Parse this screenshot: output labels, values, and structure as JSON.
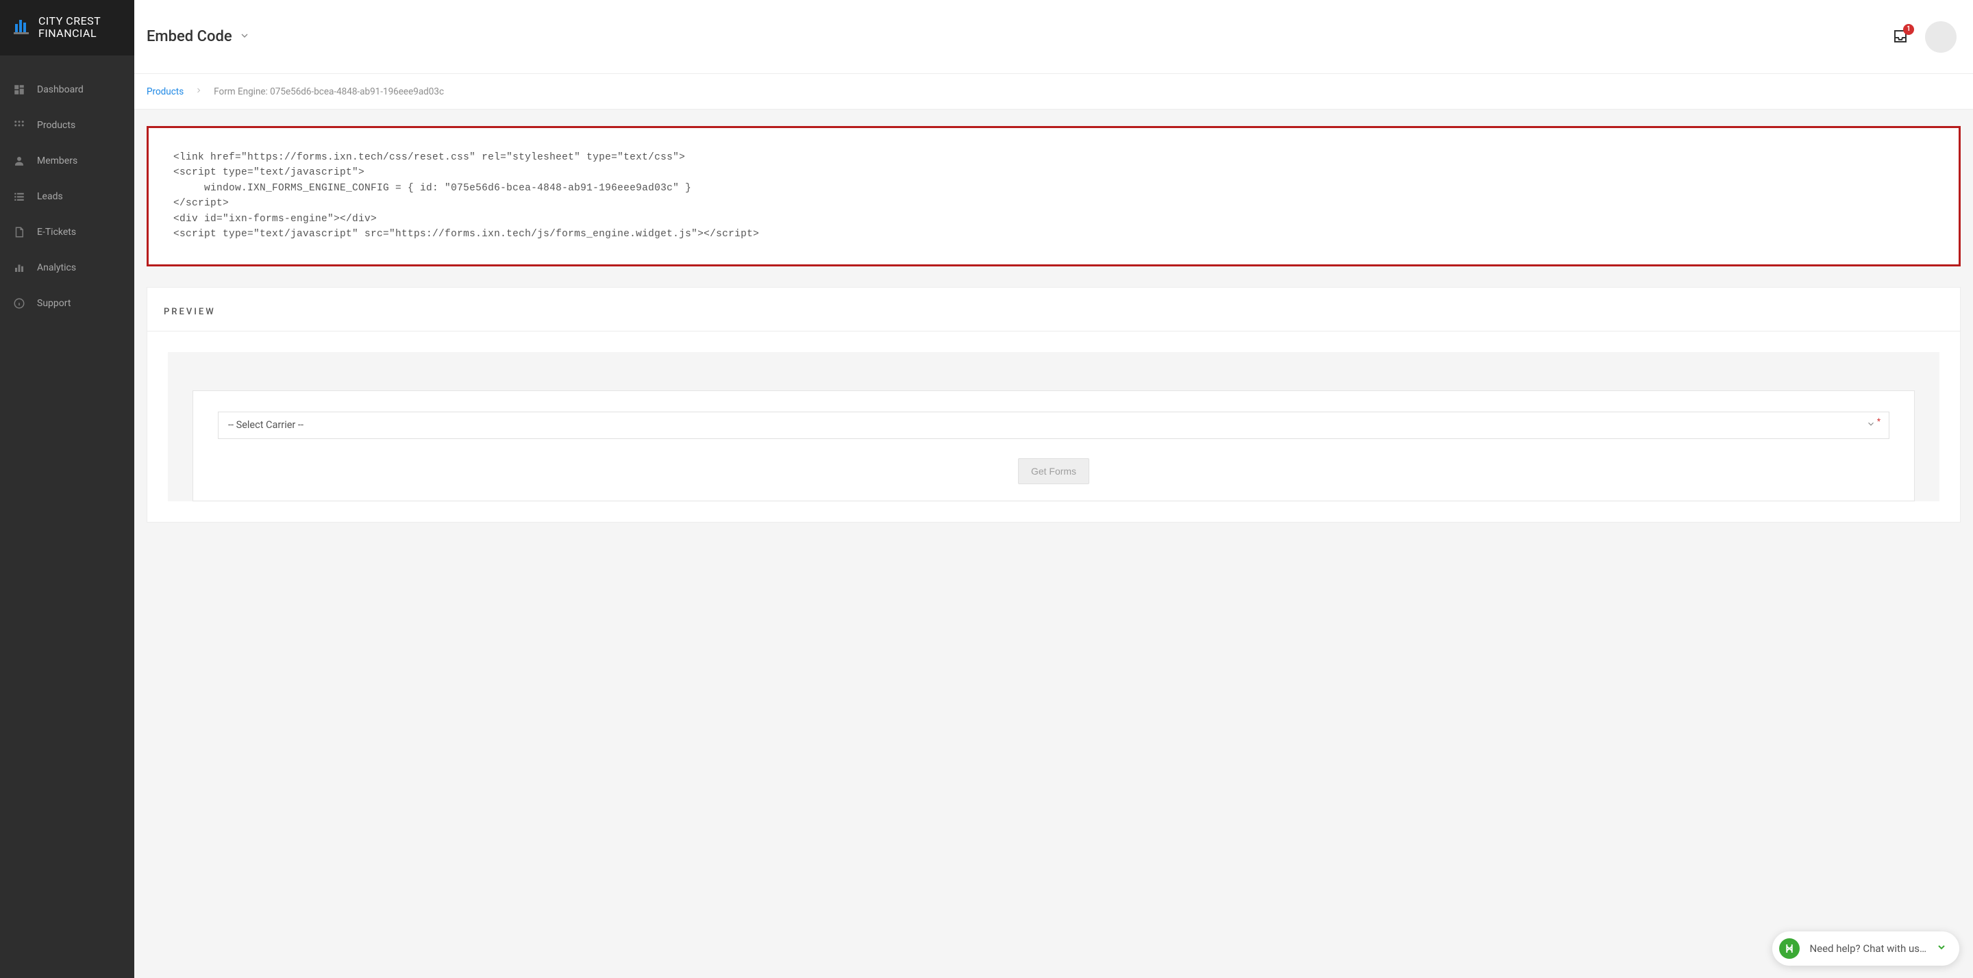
{
  "brand": {
    "name_line1": "CITY CREST",
    "name_line2": "FINANCIAL"
  },
  "nav": {
    "items": [
      {
        "label": "Dashboard",
        "icon": "dashboard-icon"
      },
      {
        "label": "Products",
        "icon": "grid-icon"
      },
      {
        "label": "Members",
        "icon": "person-icon"
      },
      {
        "label": "Leads",
        "icon": "list-icon"
      },
      {
        "label": "E-Tickets",
        "icon": "file-icon"
      },
      {
        "label": "Analytics",
        "icon": "bars-icon"
      },
      {
        "label": "Support",
        "icon": "info-icon"
      }
    ]
  },
  "header": {
    "title": "Embed Code",
    "notifications_count": "1"
  },
  "breadcrumb": {
    "root": "Products",
    "current": "Form Engine: 075e56d6-bcea-4848-ab91-196eee9ad03c"
  },
  "code": {
    "line1": "<link href=\"https://forms.ixn.tech/css/reset.css\" rel=\"stylesheet\" type=\"text/css\">",
    "line2": "<script type=\"text/javascript\">",
    "line3": "     window.IXN_FORMS_ENGINE_CONFIG = { id: \"075e56d6-bcea-4848-ab91-196eee9ad03c\" }",
    "line4": "</script>",
    "line5": "<div id=\"ixn-forms-engine\"></div>",
    "line6": "<script type=\"text/javascript\" src=\"https://forms.ixn.tech/js/forms_engine.widget.js\"></script>"
  },
  "preview": {
    "heading": "PREVIEW",
    "carrier_placeholder": "-- Select Carrier --",
    "get_forms_label": "Get Forms"
  },
  "chat": {
    "text": "Need help? Chat with us…"
  }
}
